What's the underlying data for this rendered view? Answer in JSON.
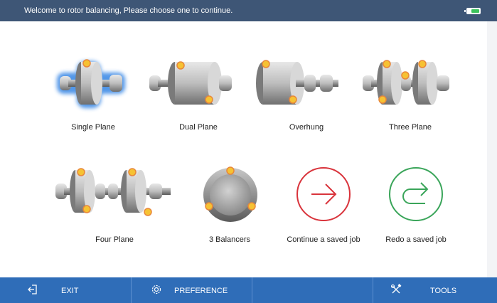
{
  "header": {
    "message": "Welcome to rotor balancing, Please choose one to continue.",
    "battery_level": 0.7,
    "battery_color": "#3cc35c",
    "icon": "battery-icon"
  },
  "options": [
    {
      "label": "Single Plane",
      "icon": "single-plane-rotor-icon",
      "selected": true
    },
    {
      "label": "Dual Plane",
      "icon": "dual-plane-rotor-icon"
    },
    {
      "label": "Overhung",
      "icon": "overhung-rotor-icon"
    },
    {
      "label": "Three Plane",
      "icon": "three-plane-rotor-icon"
    },
    {
      "label": "Four Plane",
      "icon": "four-plane-rotor-icon"
    },
    {
      "label": "3 Balancers",
      "icon": "three-balancers-icon"
    },
    {
      "label": "Continue a saved job",
      "icon": "arrow-right-circle-icon",
      "color": "#d9343c"
    },
    {
      "label": "Redo a saved job",
      "icon": "redo-circle-icon",
      "color": "#3aa55a"
    }
  ],
  "toolbar": {
    "exit_label": "EXIT",
    "preference_label": "PREFERENCE",
    "tools_label": "TOOLS",
    "background": "#2f6db8"
  },
  "colors": {
    "header_bg": "#3e5676",
    "marker": "#f6c233",
    "marker_stroke": "#e8873a"
  }
}
